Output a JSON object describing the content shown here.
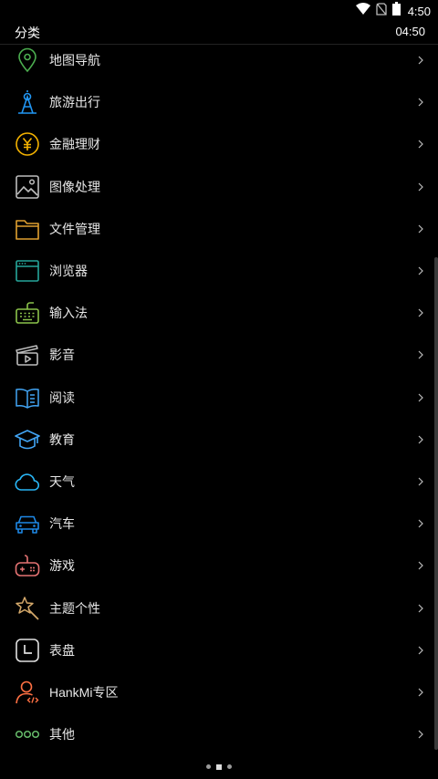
{
  "status_bar": {
    "time": "4:50",
    "icons": [
      "wifi-icon",
      "no-sim-icon",
      "battery-icon"
    ]
  },
  "header": {
    "title": "分类",
    "clock": "04:50"
  },
  "categories": [
    {
      "label": "地图导航",
      "icon": "map-pin-icon",
      "color": "#4caf50"
    },
    {
      "label": "旅游出行",
      "icon": "tower-icon",
      "color": "#2196f3"
    },
    {
      "label": "金融理财",
      "icon": "yen-coin-icon",
      "color": "#f5b300"
    },
    {
      "label": "图像处理",
      "icon": "image-icon",
      "color": "#bdbdbd"
    },
    {
      "label": "文件管理",
      "icon": "folder-icon",
      "color": "#e0a030"
    },
    {
      "label": "浏览器",
      "icon": "browser-icon",
      "color": "#26a69a"
    },
    {
      "label": "输入法",
      "icon": "keyboard-icon",
      "color": "#8bc34a"
    },
    {
      "label": "影音",
      "icon": "video-icon",
      "color": "#bdbdbd"
    },
    {
      "label": "阅读",
      "icon": "book-icon",
      "color": "#42a5f5"
    },
    {
      "label": "教育",
      "icon": "graduation-cap-icon",
      "color": "#42a5f5"
    },
    {
      "label": "天气",
      "icon": "cloud-icon",
      "color": "#29b6f6"
    },
    {
      "label": "汽车",
      "icon": "car-icon",
      "color": "#1e88e5"
    },
    {
      "label": "游戏",
      "icon": "gamepad-icon",
      "color": "#e57373"
    },
    {
      "label": "主题个性",
      "icon": "magic-wand-icon",
      "color": "#d4a86a"
    },
    {
      "label": "表盘",
      "icon": "clock-icon",
      "color": "#e0e0e0"
    },
    {
      "label": "HankMi专区",
      "icon": "user-code-icon",
      "color": "#ff7043"
    },
    {
      "label": "其他",
      "icon": "more-dots-icon",
      "color": "#66bb6a"
    }
  ],
  "pager": {
    "count": 3,
    "active": 1
  }
}
